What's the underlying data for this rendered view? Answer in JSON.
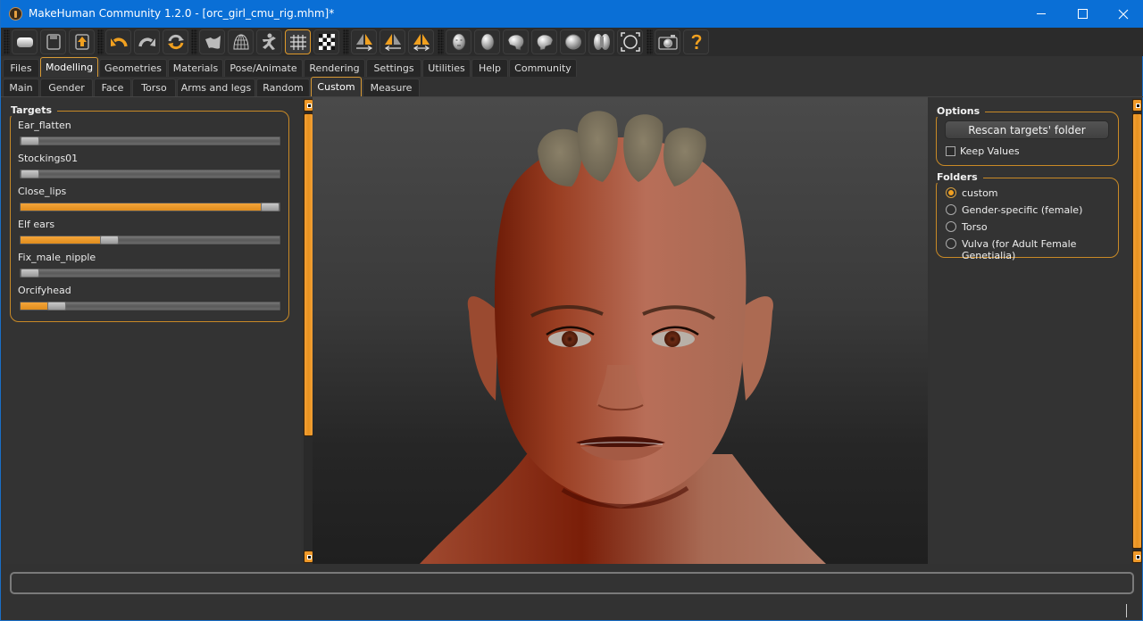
{
  "window": {
    "title": "MakeHuman Community 1.2.0 - [orc_girl_cmu_rig.mhm]*",
    "controls": {
      "minimize": "minimize",
      "maximize": "maximize",
      "close": "close"
    }
  },
  "toolbar": {
    "groups": [
      {
        "name": "file",
        "items": [
          {
            "icon": "load-icon",
            "label": "Load"
          },
          {
            "icon": "save-icon",
            "label": "Save"
          },
          {
            "icon": "export-icon",
            "label": "Export"
          }
        ]
      },
      {
        "name": "edit",
        "items": [
          {
            "icon": "undo-icon",
            "label": "Undo"
          },
          {
            "icon": "redo-icon",
            "label": "Redo"
          },
          {
            "icon": "reset-icon",
            "label": "Reset"
          }
        ]
      },
      {
        "name": "view",
        "items": [
          {
            "icon": "smooth-icon",
            "label": "Smooth"
          },
          {
            "icon": "wireframe-icon",
            "label": "Wireframe"
          },
          {
            "icon": "pose-icon",
            "label": "Pose"
          },
          {
            "icon": "grid-icon",
            "label": "Grid",
            "active": true
          },
          {
            "icon": "background-icon",
            "label": "Background"
          }
        ]
      },
      {
        "name": "symmetry",
        "items": [
          {
            "icon": "symmetry-right-icon",
            "label": "Symmetry R>L"
          },
          {
            "icon": "symmetry-left-icon",
            "label": "Symmetry L>R"
          },
          {
            "icon": "symmetry-icon",
            "label": "Symmetry"
          }
        ]
      },
      {
        "name": "camera",
        "items": [
          {
            "icon": "front-view-icon",
            "label": "Front view"
          },
          {
            "icon": "back-view-icon",
            "label": "Back view"
          },
          {
            "icon": "left-view-icon",
            "label": "Left view"
          },
          {
            "icon": "right-view-icon",
            "label": "Right view"
          },
          {
            "icon": "top-view-icon",
            "label": "Top view"
          },
          {
            "icon": "bottom-view-icon",
            "label": "Bottom view"
          },
          {
            "icon": "reset-camera-icon",
            "label": "Reset camera"
          }
        ]
      },
      {
        "name": "misc",
        "items": [
          {
            "icon": "screenshot-icon",
            "label": "Screenshot"
          },
          {
            "icon": "help-icon",
            "label": "Help"
          }
        ]
      }
    ]
  },
  "main_tabs": [
    {
      "label": "Files"
    },
    {
      "label": "Modelling",
      "active": true
    },
    {
      "label": "Geometries"
    },
    {
      "label": "Materials"
    },
    {
      "label": "Pose/Animate"
    },
    {
      "label": "Rendering"
    },
    {
      "label": "Settings"
    },
    {
      "label": "Utilities"
    },
    {
      "label": "Help"
    },
    {
      "label": "Community"
    }
  ],
  "sub_tabs": [
    {
      "label": "Main"
    },
    {
      "label": "Gender"
    },
    {
      "label": "Face"
    },
    {
      "label": "Torso"
    },
    {
      "label": "Arms and legs"
    },
    {
      "label": "Random"
    },
    {
      "label": "Custom",
      "active": true
    },
    {
      "label": "Measure"
    }
  ],
  "targets": {
    "title": "Targets",
    "items": [
      {
        "label": "Ear_flatten",
        "value": 0.0
      },
      {
        "label": "Stockings01",
        "value": 0.0
      },
      {
        "label": "Close_lips",
        "value": 1.0
      },
      {
        "label": "Elf ears",
        "value": 0.33
      },
      {
        "label": "Fix_male_nipple",
        "value": 0.0
      },
      {
        "label": "Orcifyhead",
        "value": 0.11
      }
    ]
  },
  "options": {
    "title": "Options",
    "rescan_label": "Rescan targets' folder",
    "keep_values_label": "Keep Values",
    "keep_values_checked": false
  },
  "folders": {
    "title": "Folders",
    "items": [
      {
        "label": "custom",
        "checked": true
      },
      {
        "label": "Gender-specific (female)",
        "checked": false
      },
      {
        "label": "Torso",
        "checked": false
      },
      {
        "label": "Vulva (for Adult Female Genetialia)",
        "checked": false
      }
    ]
  },
  "colors": {
    "accent": "#f0a020",
    "titlebar": "#0a6fd6",
    "background": "#323232",
    "skin": "#a85a40"
  },
  "status": {
    "text": ""
  }
}
